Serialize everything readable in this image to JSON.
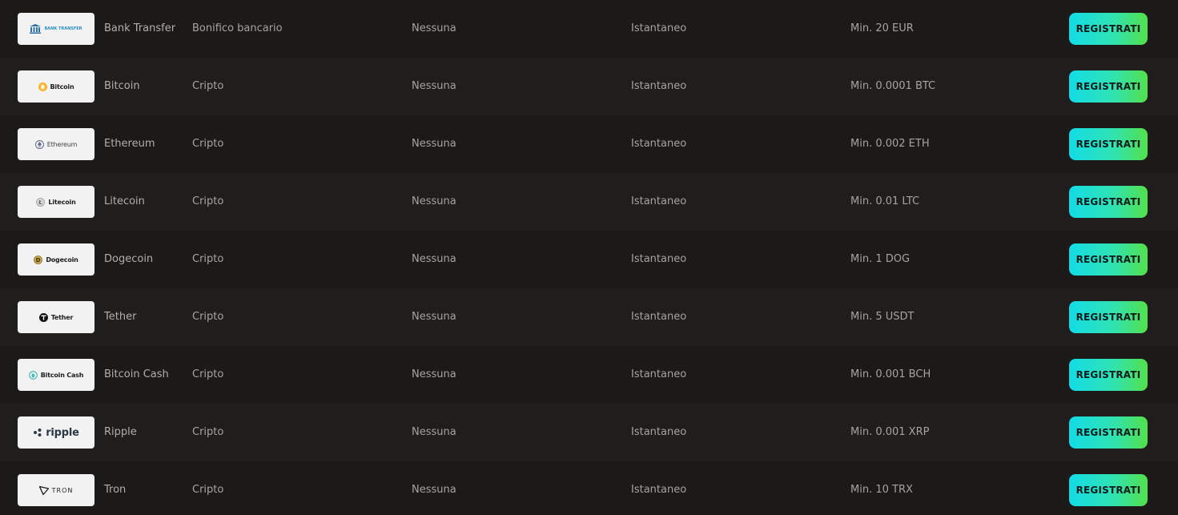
{
  "payment_methods": [
    {
      "name": "Bank Transfer",
      "type": "Bonifico bancario",
      "fee": "Nessuna",
      "time": "Istantaneo",
      "minimum": "Min. 20 EUR",
      "button": "REGISTRATI",
      "logo_icon": "bank-transfer-logo",
      "logo_text": "BANK TRANSFER"
    },
    {
      "name": "Bitcoin",
      "type": "Cripto",
      "fee": "Nessuna",
      "time": "Istantaneo",
      "minimum": "Min. 0.0001 BTC",
      "button": "REGISTRATI",
      "logo_icon": "bitcoin-logo",
      "logo_text": "Bitcoin"
    },
    {
      "name": "Ethereum",
      "type": "Cripto",
      "fee": "Nessuna",
      "time": "Istantaneo",
      "minimum": "Min. 0.002 ETH",
      "button": "REGISTRATI",
      "logo_icon": "ethereum-logo",
      "logo_text": "Ethereum"
    },
    {
      "name": "Litecoin",
      "type": "Cripto",
      "fee": "Nessuna",
      "time": "Istantaneo",
      "minimum": "Min. 0.01 LTC",
      "button": "REGISTRATI",
      "logo_icon": "litecoin-logo",
      "logo_text": "Litecoin"
    },
    {
      "name": "Dogecoin",
      "type": "Cripto",
      "fee": "Nessuna",
      "time": "Istantaneo",
      "minimum": "Min. 1 DOG",
      "button": "REGISTRATI",
      "logo_icon": "dogecoin-logo",
      "logo_text": "Dogecoin"
    },
    {
      "name": "Tether",
      "type": "Cripto",
      "fee": "Nessuna",
      "time": "Istantaneo",
      "minimum": "Min. 5 USDT",
      "button": "REGISTRATI",
      "logo_icon": "tether-logo",
      "logo_text": "Tether"
    },
    {
      "name": "Bitcoin Cash",
      "type": "Cripto",
      "fee": "Nessuna",
      "time": "Istantaneo",
      "minimum": "Min. 0.001 BCH",
      "button": "REGISTRATI",
      "logo_icon": "bitcoin-cash-logo",
      "logo_text": "Bitcoin Cash"
    },
    {
      "name": "Ripple",
      "type": "Cripto",
      "fee": "Nessuna",
      "time": "Istantaneo",
      "minimum": "Min. 0.001 XRP",
      "button": "REGISTRATI",
      "logo_icon": "ripple-logo",
      "logo_text": "ripple"
    },
    {
      "name": "Tron",
      "type": "Cripto",
      "fee": "Nessuna",
      "time": "Istantaneo",
      "minimum": "Min. 10 TRX",
      "button": "REGISTRATI",
      "logo_icon": "tron-logo",
      "logo_text": "TRON"
    }
  ],
  "colors": {
    "background": "#1b1a19",
    "row_alt": "#1f1e1d",
    "text": "#a8a39c",
    "button_gradient_start": "#13dbe6",
    "button_gradient_end": "#52e04a"
  }
}
